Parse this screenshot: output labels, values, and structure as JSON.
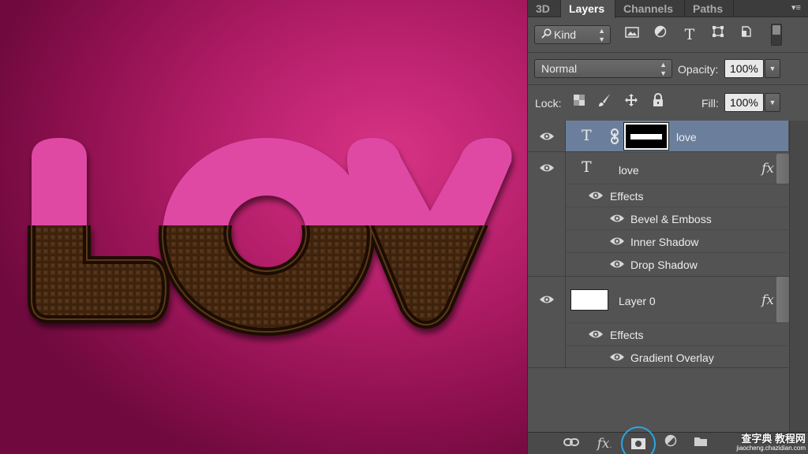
{
  "canvas": {
    "artwork_text": "LOV",
    "colors": {
      "pink_top": "#df4aa4",
      "chocolate": "#3c220f",
      "background": "#c12473"
    }
  },
  "panel": {
    "tabs": [
      {
        "label": "3D",
        "active": false
      },
      {
        "label": "Layers",
        "active": true
      },
      {
        "label": "Channels",
        "active": false
      },
      {
        "label": "Paths",
        "active": false
      }
    ],
    "menu_icon": "panel-menu-icon",
    "filter": {
      "kind_label": "Kind",
      "search_icon": "search-icon"
    },
    "blend_mode": "Normal",
    "opacity_label": "Opacity:",
    "opacity_value": "100%",
    "lock_label": "Lock:",
    "fill_label": "Fill:",
    "fill_value": "100%",
    "layers": [
      {
        "name": "love",
        "type": "text",
        "selected": true,
        "has_mask": true
      },
      {
        "name": "love",
        "type": "text",
        "selected": false,
        "fx": "fx",
        "effects_label": "Effects",
        "effects": [
          "Bevel & Emboss",
          "Inner Shadow",
          "Drop Shadow"
        ]
      },
      {
        "name": "Layer 0",
        "type": "pixel",
        "selected": false,
        "fx": "fx",
        "effects_label": "Effects",
        "effects": [
          "Gradient Overlay"
        ]
      }
    ],
    "bottom_icons": [
      "link-layers-icon",
      "fx-icon",
      "add-mask-icon",
      "adjustment-layer-icon",
      "new-group-icon"
    ],
    "highlight_color": "#2aa6e6",
    "watermark": {
      "line1": "查字典 教程网",
      "line2": "jiaocheng.chazidian.com"
    }
  }
}
